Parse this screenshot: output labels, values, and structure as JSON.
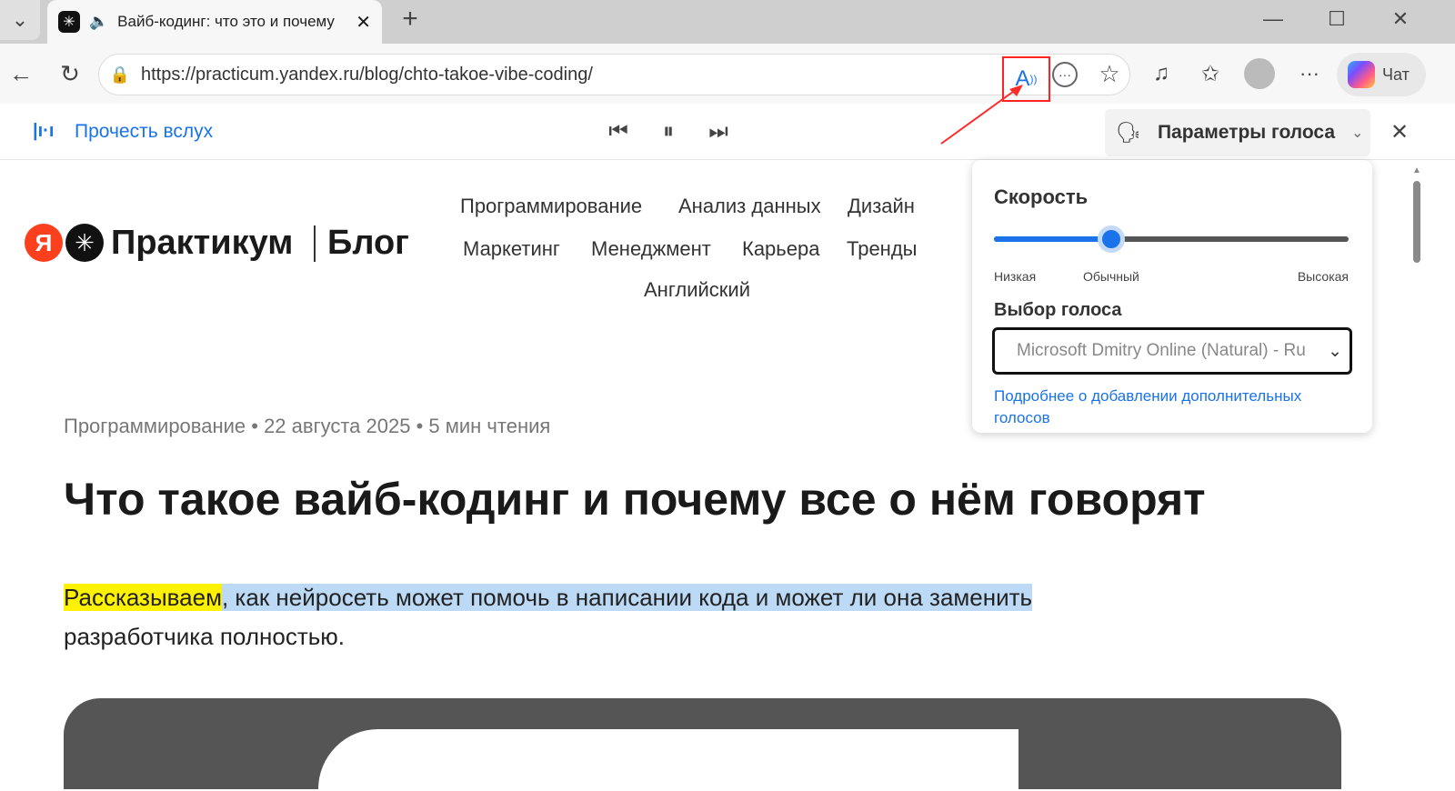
{
  "browser": {
    "tab_title": "Вайб-кодинг: что это и почему",
    "url": "https://practicum.yandex.ru/blog/chto-takoe-vibe-coding/",
    "chat_label": "Чат"
  },
  "read_aloud": {
    "label": "Прочесть вслух",
    "voice_params": "Параметры голоса"
  },
  "voice_popup": {
    "speed_title": "Скорость",
    "speed_low": "Низкая",
    "speed_normal": "Обычный",
    "speed_high": "Высокая",
    "speed_level": 0.33,
    "voice_title": "Выбор голоса",
    "voice_selected": "Microsoft Dmitry Online (Natural) - Ru",
    "more_voices_link": "Подробнее о добавлении дополнительных голосов"
  },
  "site": {
    "logo_text": "Практикум",
    "blog_text": "Блог",
    "nav": [
      "Программирование",
      "Анализ данных",
      "Дизайн",
      "Маркетинг",
      "Менеджмент",
      "Карьера",
      "Тренды",
      "Английский"
    ]
  },
  "article": {
    "meta": "Программирование • 22 августа 2025 • 5 мин чтения",
    "title": "Что такое вайб-кодинг и почему все о нём говорят",
    "lead_current_word": "Рассказываем",
    "lead_current_sentence": ", как нейросеть может помочь в написании кода и может ли она заменить",
    "lead_rest": "разработчика полностью."
  },
  "colors": {
    "accent": "#1a73e8",
    "annotation": "#ff2a2a",
    "word_highlight": "#fef200",
    "sentence_highlight": "#bcd9f5"
  }
}
